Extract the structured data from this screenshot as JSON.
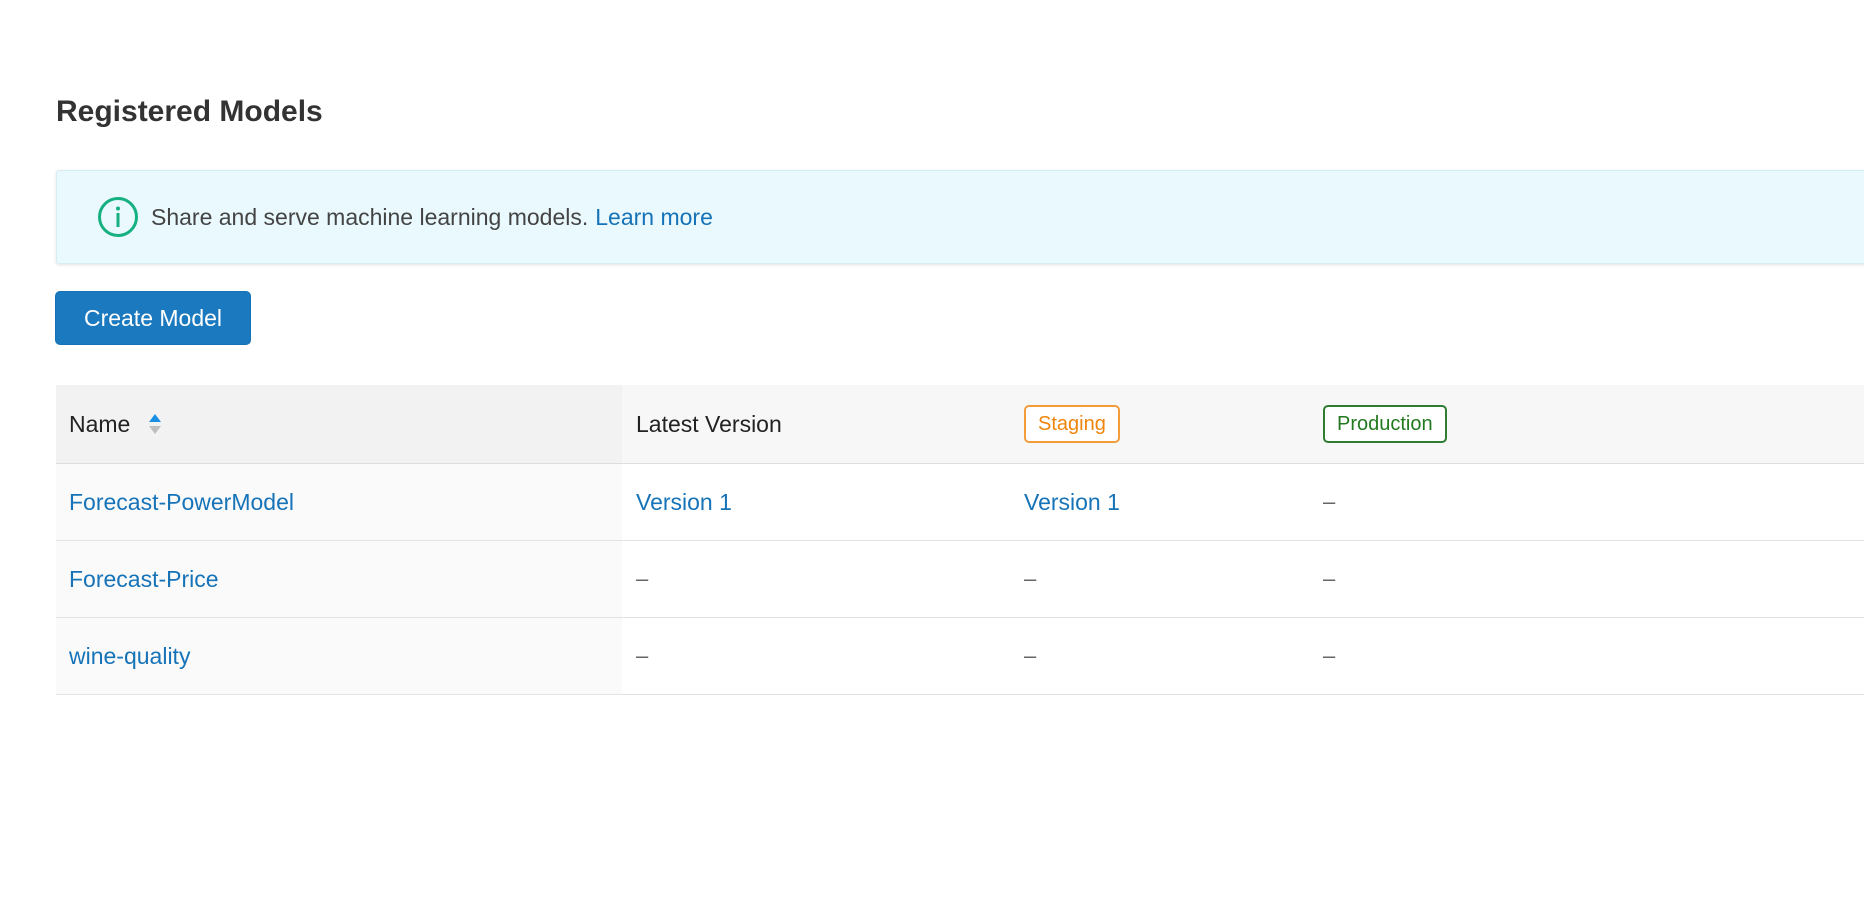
{
  "page": {
    "title": "Registered Models"
  },
  "banner": {
    "icon": "info-icon",
    "message": "Share and serve machine learning models.",
    "link_label": "Learn more"
  },
  "toolbar": {
    "create_label": "Create Model"
  },
  "table": {
    "columns": {
      "name": "Name",
      "latest": "Latest Version",
      "staging": "Staging",
      "production": "Production"
    },
    "sort": "ascending",
    "rows": [
      {
        "name": "Forecast-PowerModel",
        "latest": "Version 1",
        "staging": "Version 1",
        "production": "–"
      },
      {
        "name": "Forecast-Price",
        "latest": "–",
        "staging": "–",
        "production": "–"
      },
      {
        "name": "wine-quality",
        "latest": "–",
        "staging": "–",
        "production": "–"
      }
    ]
  },
  "colors": {
    "primary": "#1a79bf",
    "link": "#1673b8",
    "banner_bg": "#e9f9fd",
    "info_icon": "#16b081",
    "staging": "#f0850c",
    "production": "#22791f"
  }
}
